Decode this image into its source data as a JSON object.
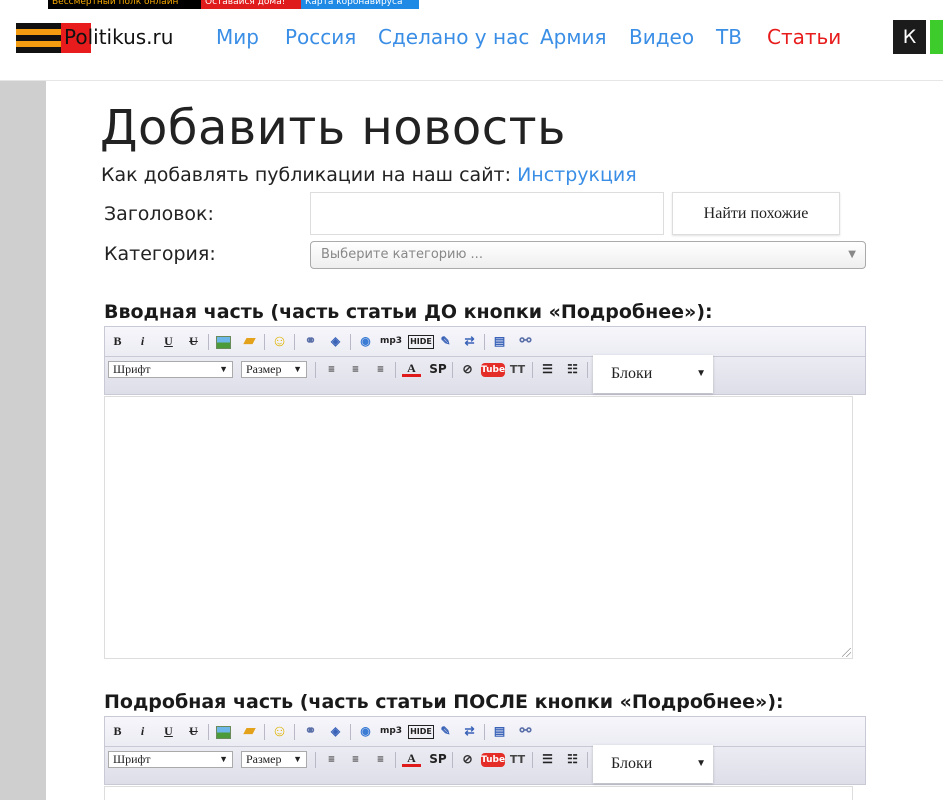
{
  "promo": {
    "item1": "Бессмертный полк онлайн",
    "item2": "Оставайся дома!",
    "item3": "Карта коронавируса"
  },
  "site": {
    "logo_text": "Politikus.ru"
  },
  "nav": [
    {
      "label": "Мир"
    },
    {
      "label": "Россия"
    },
    {
      "label": "Сделано у нас"
    },
    {
      "label": "Армия"
    },
    {
      "label": "Видео"
    },
    {
      "label": "ТВ"
    },
    {
      "label": "Статьи"
    }
  ],
  "nav_colors": {
    "link": "#3a8ee6",
    "active": "#e81c1c"
  },
  "header_right": {
    "k_label": "К"
  },
  "page": {
    "title": "Добавить новость",
    "howto_prefix": "Как добавлять публикации на наш сайт: ",
    "howto_link": "Инструкция"
  },
  "form": {
    "title_label": "Заголовок:",
    "title_value": "",
    "find_similar_label": "Найти похожие",
    "category_label": "Категория:",
    "category_placeholder": "Выберите категорию ..."
  },
  "editor1": {
    "section_title": "Вводная часть (часть статьи ДО кнопки «Подробнее»):"
  },
  "editor2": {
    "section_title": "Подробная часть (часть статьи ПОСЛЕ кнопки «Подробнее»):"
  },
  "toolbar": {
    "bold": "B",
    "italic": "i",
    "underline": "U",
    "strike": "U",
    "mp3": "mp3",
    "hide": "HIDE",
    "font_select": "Шрифт",
    "size_select": "Размер",
    "spoiler": "SP",
    "youtube": "Tube",
    "typograph": "TT",
    "blocks_select": "Блоки"
  },
  "icons": {
    "image": "image-icon",
    "folder": "folder-icon",
    "smile": "smile-icon",
    "link": "link-icon",
    "leech": "leech-icon",
    "media": "media-icon",
    "quote": "quote-icon",
    "code": "code-icon",
    "page-break": "page-break-icon",
    "url-link": "url-link-icon",
    "align-left": "align-left-icon",
    "align-center": "align-center-icon",
    "align-right": "align-right-icon",
    "color": "text-color-icon",
    "flash": "flash-icon",
    "list-bullet": "bullet-list-icon",
    "list-numbered": "numbered-list-icon"
  }
}
